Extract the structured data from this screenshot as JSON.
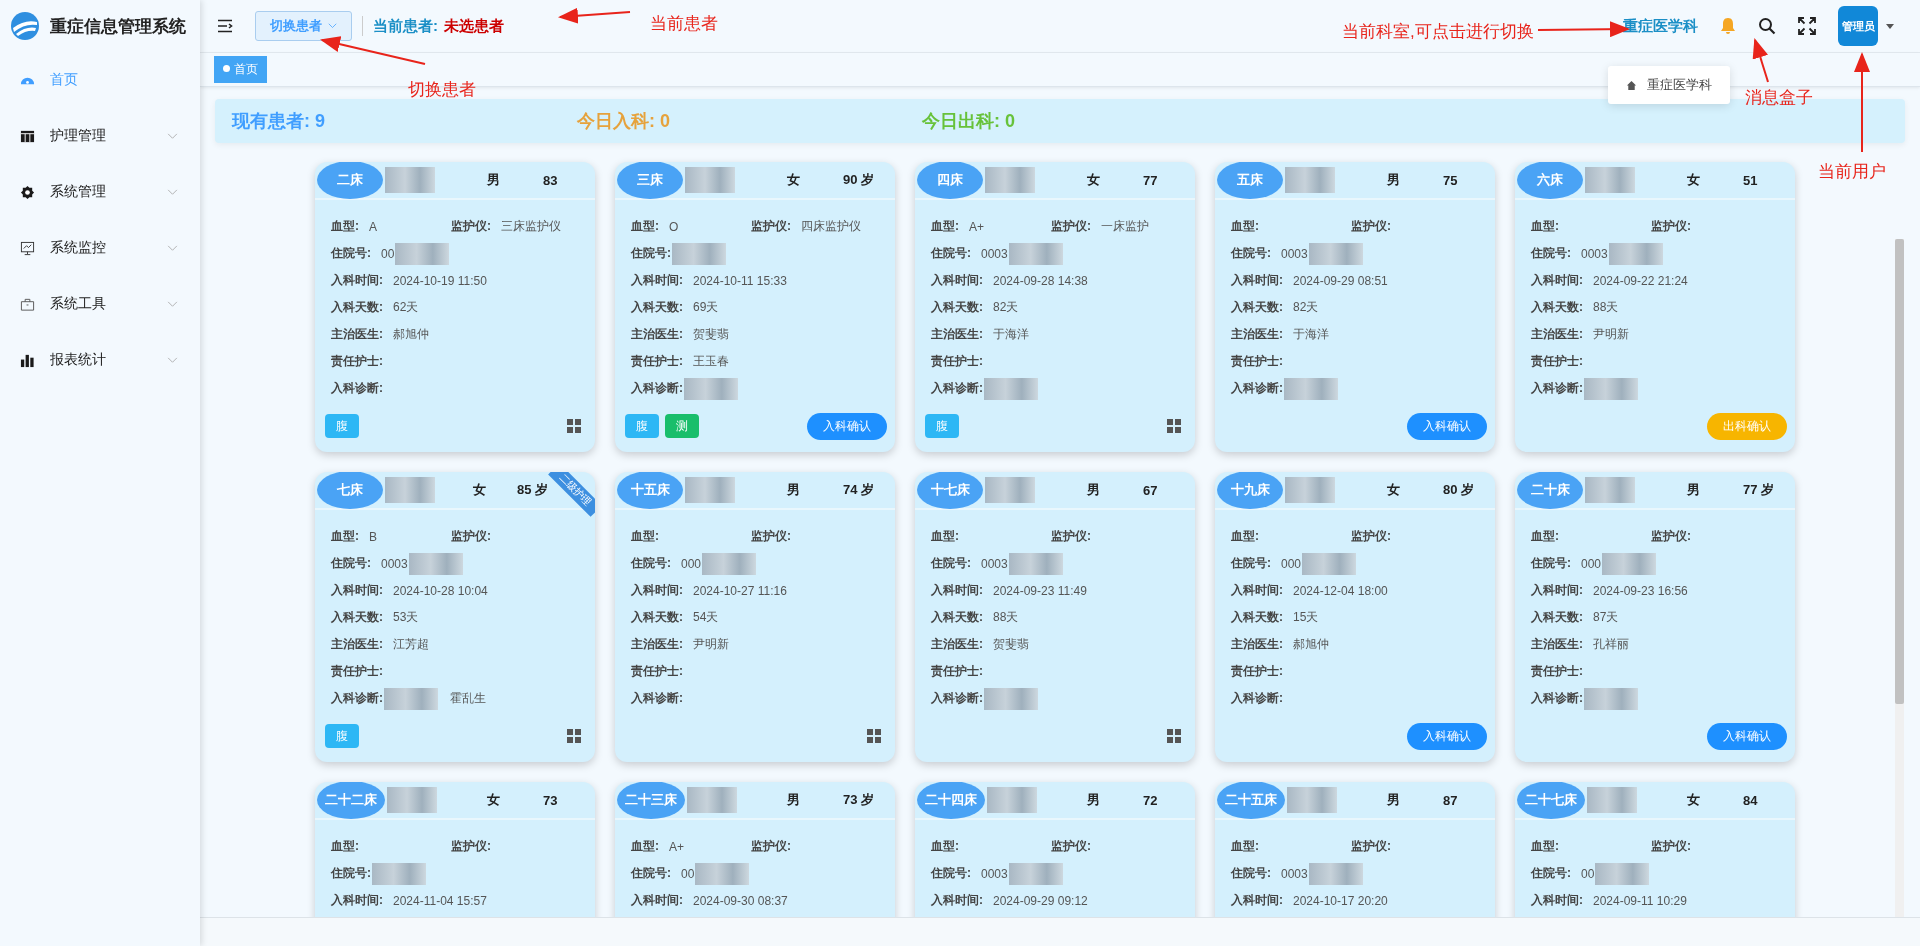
{
  "app": {
    "title": "重症信息管理系统"
  },
  "sidebar": {
    "items": [
      {
        "label": "首页",
        "kind": "link",
        "selected": true
      },
      {
        "label": "护理管理",
        "kind": "group",
        "selected": false
      },
      {
        "label": "系统管理",
        "kind": "group",
        "selected": false
      },
      {
        "label": "系统监控",
        "kind": "group",
        "selected": false
      },
      {
        "label": "系统工具",
        "kind": "group",
        "selected": false
      },
      {
        "label": "报表统计",
        "kind": "group",
        "selected": false
      }
    ]
  },
  "header": {
    "switch_button": "切换患者",
    "patient_label": "当前患者:",
    "patient_value": "未选患者",
    "department": "重症医学科",
    "user": "管理员"
  },
  "department_menu": {
    "items": [
      "重症医学科"
    ]
  },
  "tags": [
    {
      "label": "首页",
      "selected": true
    }
  ],
  "summary": [
    {
      "text": "现有患者: 9",
      "color": "#409eff"
    },
    {
      "text": "今日入科: 0",
      "color": "#e6a23c"
    },
    {
      "text": "今日出科: 0",
      "color": "#67c23a"
    }
  ],
  "cards": [
    {
      "bed": "二床",
      "gender": "男",
      "age": "83",
      "top": [
        {
          "label": "血型:",
          "value": "A"
        },
        {
          "label": "监护仪:",
          "value": "三床监护仪"
        }
      ],
      "fields": [
        {
          "label": "住院号:",
          "value": "00",
          "redacted": true
        },
        {
          "label": "入科时间:",
          "value": "2024-10-19 11:50"
        },
        {
          "label": "入科天数:",
          "value": "62天"
        },
        {
          "label": "主治医生:",
          "value": "郝旭仲"
        },
        {
          "label": "责任护士:"
        },
        {
          "label": "入科诊断:"
        }
      ],
      "tags": [
        {
          "label": "腹",
          "color": "#2db7f5"
        }
      ],
      "grid": true
    },
    {
      "bed": "三床",
      "gender": "女",
      "age": "90 岁",
      "top": [
        {
          "label": "血型:",
          "value": "O"
        },
        {
          "label": "监护仪:",
          "value": "四床监护仪"
        }
      ],
      "fields": [
        {
          "label": "住院号:",
          "redacted": true
        },
        {
          "label": "入科时间:",
          "value": "2024-10-11 15:33"
        },
        {
          "label": "入科天数:",
          "value": "69天"
        },
        {
          "label": "主治医生:",
          "value": "贺斐翡"
        },
        {
          "label": "责任护士:",
          "value": "王玉春"
        },
        {
          "label": "入科诊断:",
          "redacted": true
        }
      ],
      "tags": [
        {
          "label": "腹",
          "color": "#2db7f5"
        },
        {
          "label": "测",
          "color": "#19be6b"
        }
      ],
      "action": {
        "label": "入科确认",
        "kind": "admit"
      }
    },
    {
      "bed": "四床",
      "gender": "女",
      "age": "77",
      "top": [
        {
          "label": "血型:",
          "value": "A+"
        },
        {
          "label": "监护仪:",
          "value": "一床监护"
        }
      ],
      "fields": [
        {
          "label": "住院号:",
          "value": "0003",
          "redacted": true
        },
        {
          "label": "入科时间:",
          "value": "2024-09-28 14:38"
        },
        {
          "label": "入科天数:",
          "value": "82天"
        },
        {
          "label": "主治医生:",
          "value": "于海洋"
        },
        {
          "label": "责任护士:"
        },
        {
          "label": "入科诊断:",
          "redacted": true
        }
      ],
      "tags": [
        {
          "label": "腹",
          "color": "#2db7f5"
        }
      ],
      "grid": true
    },
    {
      "bed": "五床",
      "gender": "男",
      "age": "75",
      "top": [
        {
          "label": "血型:"
        },
        {
          "label": "监护仪:"
        }
      ],
      "fields": [
        {
          "label": "住院号:",
          "value": "0003",
          "redacted": true
        },
        {
          "label": "入科时间:",
          "value": "2024-09-29 08:51"
        },
        {
          "label": "入科天数:",
          "value": "82天"
        },
        {
          "label": "主治医生:",
          "value": "于海洋"
        },
        {
          "label": "责任护士:"
        },
        {
          "label": "入科诊断:",
          "redacted": true
        }
      ],
      "action": {
        "label": "入科确认",
        "kind": "admit"
      }
    },
    {
      "bed": "六床",
      "gender": "女",
      "age": "51",
      "top": [
        {
          "label": "血型:"
        },
        {
          "label": "监护仪:"
        }
      ],
      "fields": [
        {
          "label": "住院号:",
          "value": "0003",
          "redacted": true
        },
        {
          "label": "入科时间:",
          "value": "2024-09-22 21:24"
        },
        {
          "label": "入科天数:",
          "value": "88天"
        },
        {
          "label": "主治医生:",
          "value": "尹明新"
        },
        {
          "label": "责任护士:"
        },
        {
          "label": "入科诊断:",
          "redacted": true
        }
      ],
      "action": {
        "label": "出科确认",
        "kind": "discharge"
      }
    },
    {
      "bed": "七床",
      "gender": "女",
      "age": "85 岁",
      "ribbon": "二级护理",
      "top": [
        {
          "label": "血型:",
          "value": "B"
        },
        {
          "label": "监护仪:"
        }
      ],
      "fields": [
        {
          "label": "住院号:",
          "value": "0003",
          "redacted": true
        },
        {
          "label": "入科时间:",
          "value": "2024-10-28 10:04"
        },
        {
          "label": "入科天数:",
          "value": "53天"
        },
        {
          "label": "主治医生:",
          "value": "江芳超"
        },
        {
          "label": "责任护士:"
        },
        {
          "label": "入科诊断:",
          "redacted": true,
          "tail": "霍乱生"
        }
      ],
      "tags": [
        {
          "label": "腹",
          "color": "#2db7f5"
        }
      ],
      "grid": true
    },
    {
      "bed": "十五床",
      "gender": "男",
      "age": "74 岁",
      "top": [
        {
          "label": "血型:"
        },
        {
          "label": "监护仪:"
        }
      ],
      "fields": [
        {
          "label": "住院号:",
          "value": "000",
          "redacted": true
        },
        {
          "label": "入科时间:",
          "value": "2024-10-27 11:16"
        },
        {
          "label": "入科天数:",
          "value": "54天"
        },
        {
          "label": "主治医生:",
          "value": "尹明新"
        },
        {
          "label": "责任护士:"
        },
        {
          "label": "入科诊断:"
        }
      ],
      "grid": true
    },
    {
      "bed": "十七床",
      "gender": "男",
      "age": "67",
      "top": [
        {
          "label": "血型:"
        },
        {
          "label": "监护仪:"
        }
      ],
      "fields": [
        {
          "label": "住院号:",
          "value": "0003",
          "redacted": true
        },
        {
          "label": "入科时间:",
          "value": "2024-09-23 11:49"
        },
        {
          "label": "入科天数:",
          "value": "88天"
        },
        {
          "label": "主治医生:",
          "value": "贺斐翡"
        },
        {
          "label": "责任护士:"
        },
        {
          "label": "入科诊断:",
          "redacted": true
        }
      ],
      "grid": true
    },
    {
      "bed": "十九床",
      "gender": "女",
      "age": "80 岁",
      "top": [
        {
          "label": "血型:"
        },
        {
          "label": "监护仪:"
        }
      ],
      "fields": [
        {
          "label": "住院号:",
          "value": "000",
          "redacted": true
        },
        {
          "label": "入科时间:",
          "value": "2024-12-04 18:00"
        },
        {
          "label": "入科天数:",
          "value": "15天"
        },
        {
          "label": "主治医生:",
          "value": "郝旭仲"
        },
        {
          "label": "责任护士:"
        },
        {
          "label": "入科诊断:"
        }
      ],
      "action": {
        "label": "入科确认",
        "kind": "admit"
      }
    },
    {
      "bed": "二十床",
      "gender": "男",
      "age": "77 岁",
      "top": [
        {
          "label": "血型:"
        },
        {
          "label": "监护仪:"
        }
      ],
      "fields": [
        {
          "label": "住院号:",
          "value": "000",
          "redacted": true
        },
        {
          "label": "入科时间:",
          "value": "2024-09-23 16:56"
        },
        {
          "label": "入科天数:",
          "value": "87天"
        },
        {
          "label": "主治医生:",
          "value": "孔祥丽"
        },
        {
          "label": "责任护士:"
        },
        {
          "label": "入科诊断:",
          "redacted": true
        }
      ],
      "action": {
        "label": "入科确认",
        "kind": "admit"
      }
    },
    {
      "bed": "二十二床",
      "gender": "女",
      "age": "73",
      "top": [
        {
          "label": "血型:"
        },
        {
          "label": "监护仪:"
        }
      ],
      "fields": [
        {
          "label": "住院号:",
          "redacted": true
        },
        {
          "label": "入科时间:",
          "value": "2024-11-04 15:57"
        }
      ]
    },
    {
      "bed": "二十三床",
      "gender": "男",
      "age": "73 岁",
      "top": [
        {
          "label": "血型:",
          "value": "A+"
        },
        {
          "label": "监护仪:"
        }
      ],
      "fields": [
        {
          "label": "住院号:",
          "value": "00",
          "redacted": true
        },
        {
          "label": "入科时间:",
          "value": "2024-09-30 08:37"
        }
      ]
    },
    {
      "bed": "二十四床",
      "gender": "男",
      "age": "72",
      "top": [
        {
          "label": "血型:"
        },
        {
          "label": "监护仪:"
        }
      ],
      "fields": [
        {
          "label": "住院号:",
          "value": "0003",
          "redacted": true
        },
        {
          "label": "入科时间:",
          "value": "2024-09-29 09:12"
        }
      ]
    },
    {
      "bed": "二十五床",
      "gender": "男",
      "age": "87",
      "top": [
        {
          "label": "血型:"
        },
        {
          "label": "监护仪:"
        }
      ],
      "fields": [
        {
          "label": "住院号:",
          "value": "0003",
          "redacted": true
        },
        {
          "label": "入科时间:",
          "value": "2024-10-17 20:20"
        }
      ]
    },
    {
      "bed": "二十七床",
      "gender": "女",
      "age": "84",
      "top": [
        {
          "label": "血型:"
        },
        {
          "label": "监护仪:"
        }
      ],
      "fields": [
        {
          "label": "住院号:",
          "value": "00",
          "redacted": true
        },
        {
          "label": "入科时间:",
          "value": "2024-09-11 10:29"
        }
      ]
    }
  ],
  "annotations": [
    {
      "text": "当前患者"
    },
    {
      "text": "切换患者"
    },
    {
      "text": "当前科室,可点击进行切换"
    },
    {
      "text": "消息盒子"
    },
    {
      "text": "当前用户"
    }
  ]
}
